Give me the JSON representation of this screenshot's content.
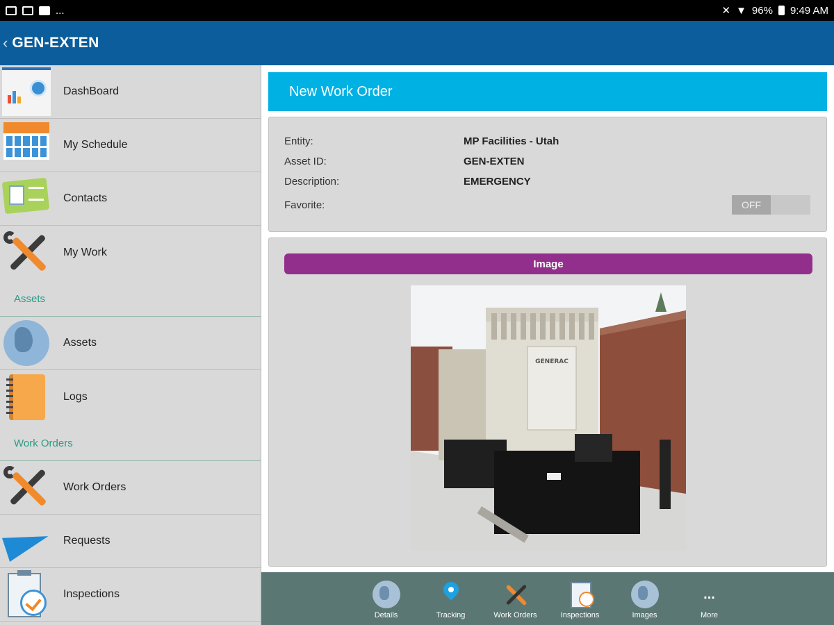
{
  "status_bar": {
    "overflow": "...",
    "battery": "96%",
    "time": "9:49 AM"
  },
  "app_bar": {
    "back_glyph": "‹",
    "title": "GEN-EXTEN"
  },
  "sidebar": {
    "items_top": [
      {
        "label": "DashBoard",
        "icon": "dashboard-icon"
      },
      {
        "label": "My Schedule",
        "icon": "calendar-icon"
      },
      {
        "label": "Contacts",
        "icon": "contacts-card-icon"
      },
      {
        "label": "My Work",
        "icon": "tools-icon"
      }
    ],
    "section_assets": "Assets",
    "items_assets": [
      {
        "label": "Assets",
        "icon": "globe-icon"
      },
      {
        "label": "Logs",
        "icon": "logbook-icon"
      }
    ],
    "section_work_orders": "Work Orders",
    "items_work_orders": [
      {
        "label": "Work Orders",
        "icon": "tools-icon"
      },
      {
        "label": "Requests",
        "icon": "paper-plane-icon"
      },
      {
        "label": "Inspections",
        "icon": "clipboard-check-icon"
      }
    ]
  },
  "work_order": {
    "header": "New Work Order",
    "fields": [
      {
        "label": "Entity:",
        "value": "MP Facilities - Utah"
      },
      {
        "label": "Asset ID:",
        "value": "GEN-EXTEN"
      },
      {
        "label": "Description:",
        "value": "EMERGENCY"
      }
    ],
    "favorite_label": "Favorite:",
    "favorite_state": "OFF",
    "image_section_label": "Image",
    "photo_brand": "GENERAC"
  },
  "tab_bar": {
    "tabs": [
      {
        "label": "Details",
        "icon": "globe-icon"
      },
      {
        "label": "Tracking",
        "icon": "location-pin-icon"
      },
      {
        "label": "Work Orders",
        "icon": "tools-icon"
      },
      {
        "label": "Inspections",
        "icon": "clipboard-check-icon"
      },
      {
        "label": "Images",
        "icon": "globe-icon"
      },
      {
        "label": "More",
        "icon": "more-dots-icon",
        "glyph": "..."
      }
    ]
  },
  "colors": {
    "app_bar": "#0b5d9b",
    "header": "#00b1e3",
    "image_bar": "#922f8c",
    "section_text": "#2a9c86",
    "tab_bar": "#5b7774"
  }
}
